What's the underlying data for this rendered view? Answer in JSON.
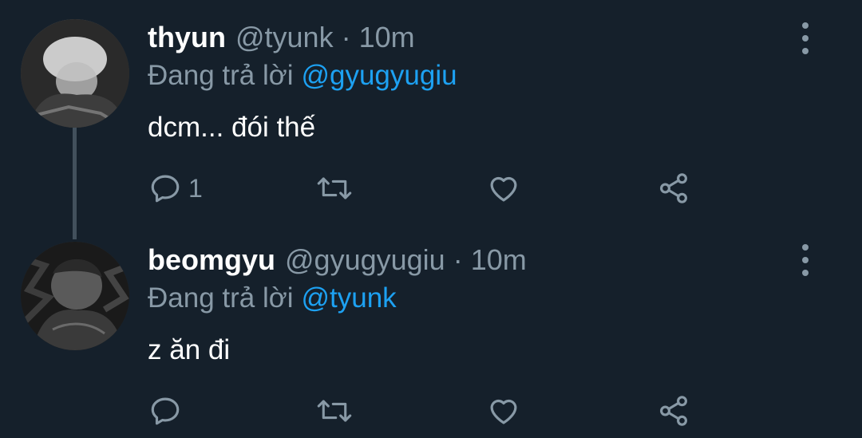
{
  "tweets": [
    {
      "display_name": "thyun",
      "handle": "@tyunk",
      "time": "10m",
      "reply_prefix": "Đang trả lời",
      "reply_to": "@gyugyugiu",
      "text": "dcm... đói thế",
      "reply_count": "1"
    },
    {
      "display_name": "beomgyu",
      "handle": "@gyugyugiu",
      "time": "10m",
      "reply_prefix": "Đang trả lời",
      "reply_to": "@tyunk",
      "text": "z ăn đi",
      "reply_count": ""
    }
  ],
  "separator": "·",
  "colors": {
    "background": "#15202b",
    "secondary_text": "#8899a6",
    "accent": "#1da1f2",
    "thread_line": "#42505c"
  },
  "icons": {
    "reply": "reply-icon",
    "retweet": "retweet-icon",
    "like": "heart-icon",
    "share": "share-icon",
    "more": "more-vertical-icon"
  }
}
